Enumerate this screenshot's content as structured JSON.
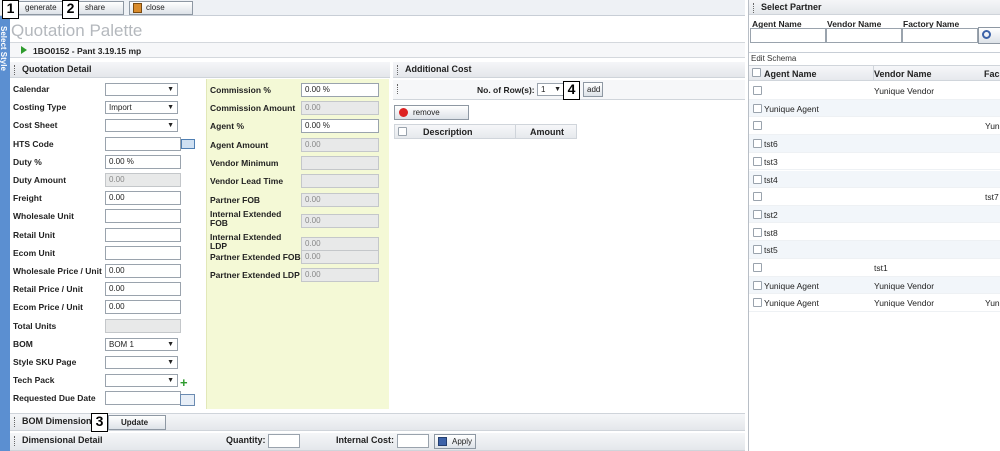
{
  "toolbar": {
    "generate": "generate",
    "share": "share",
    "close": "close"
  },
  "badges": [
    "1",
    "2",
    "3",
    "4"
  ],
  "sidetab": "Select Style",
  "title": "Quotation Palette",
  "item": "1BO0152 - Pant 3.19.15 mp",
  "quotation_detail": {
    "header": "Quotation Detail",
    "left_fields": [
      {
        "label": "Calendar",
        "value": "",
        "kind": "select"
      },
      {
        "label": "Costing Type",
        "value": "Import",
        "kind": "select"
      },
      {
        "label": "Cost Sheet",
        "value": "",
        "kind": "select"
      },
      {
        "label": "HTS Code",
        "value": "",
        "kind": "input"
      },
      {
        "label": "Duty %",
        "value": "0.00 %",
        "kind": "input"
      },
      {
        "label": "Duty Amount",
        "value": "0.00",
        "kind": "ro"
      },
      {
        "label": "Freight",
        "value": "0.00",
        "kind": "input"
      },
      {
        "label": "Wholesale Unit",
        "value": "",
        "kind": "input"
      },
      {
        "label": "Retail Unit",
        "value": "",
        "kind": "input"
      },
      {
        "label": "Ecom Unit",
        "value": "",
        "kind": "input"
      },
      {
        "label": "Wholesale Price / Unit",
        "value": "0.00",
        "kind": "input"
      },
      {
        "label": "Retail Price / Unit",
        "value": "0.00",
        "kind": "input"
      },
      {
        "label": "Ecom Price / Unit",
        "value": "0.00",
        "kind": "input"
      },
      {
        "label": "Total Units",
        "value": "",
        "kind": "ro"
      },
      {
        "label": "BOM",
        "value": "BOM 1",
        "kind": "select"
      },
      {
        "label": "Style SKU Page",
        "value": "",
        "kind": "select"
      },
      {
        "label": "Tech Pack",
        "value": "",
        "kind": "select"
      },
      {
        "label": "Requested Due Date",
        "value": "",
        "kind": "input"
      }
    ],
    "right_fields": [
      {
        "label": "Commission %",
        "value": "0.00 %",
        "kind": "input"
      },
      {
        "label": "Commission Amount",
        "value": "0.00",
        "kind": "ro"
      },
      {
        "label": "Agent %",
        "value": "0.00 %",
        "kind": "input"
      },
      {
        "label": "Agent Amount",
        "value": "0.00",
        "kind": "ro"
      },
      {
        "label": "Vendor Minimum",
        "value": "",
        "kind": "ro"
      },
      {
        "label": "Vendor Lead Time",
        "value": "",
        "kind": "ro"
      },
      {
        "label": "Partner FOB",
        "value": "0.00",
        "kind": "ro"
      },
      {
        "label": "Internal Extended FOB",
        "value": "0.00",
        "kind": "ro"
      },
      {
        "label": "Internal Extended LDP",
        "value": "0.00",
        "kind": "ro"
      },
      {
        "label": "Partner Extended FOB",
        "value": "0.00",
        "kind": "ro"
      },
      {
        "label": "Partner Extended LDP",
        "value": "0.00",
        "kind": "ro"
      }
    ]
  },
  "additional_cost": {
    "header": "Additional Cost",
    "rows_label": "No. of Row(s):",
    "rows_value": "1",
    "add": "add",
    "remove": "remove",
    "columns": [
      "Description",
      "Amount"
    ]
  },
  "bom_dimensions": {
    "header": "BOM Dimensions",
    "update": "Update"
  },
  "dimensional_detail": {
    "header": "Dimensional Detail",
    "quantity_label": "Quantity:",
    "internal_cost_label": "Internal Cost:",
    "apply": "Apply"
  },
  "partner": {
    "header": "Select Partner",
    "search_labels": [
      "Agent Name",
      "Vendor Name",
      "Factory Name"
    ],
    "edit_schema": "Edit Schema",
    "columns": [
      "Agent Name",
      "Vendor Name",
      "Fac"
    ],
    "rows": [
      {
        "agent": "",
        "vendor": "Yunique Vendor",
        "factory": ""
      },
      {
        "agent": "Yunique Agent",
        "vendor": "",
        "factory": ""
      },
      {
        "agent": "",
        "vendor": "",
        "factory": "Yun"
      },
      {
        "agent": "tst6",
        "vendor": "",
        "factory": ""
      },
      {
        "agent": "tst3",
        "vendor": "",
        "factory": ""
      },
      {
        "agent": "tst4",
        "vendor": "",
        "factory": ""
      },
      {
        "agent": "",
        "vendor": "",
        "factory": "tst7"
      },
      {
        "agent": "tst2",
        "vendor": "",
        "factory": ""
      },
      {
        "agent": "tst8",
        "vendor": "",
        "factory": ""
      },
      {
        "agent": "tst5",
        "vendor": "",
        "factory": ""
      },
      {
        "agent": "",
        "vendor": "tst1",
        "factory": ""
      },
      {
        "agent": "Yunique Agent",
        "vendor": "Yunique Vendor",
        "factory": ""
      },
      {
        "agent": "Yunique Agent",
        "vendor": "Yunique Vendor",
        "factory": "Yun"
      }
    ]
  }
}
